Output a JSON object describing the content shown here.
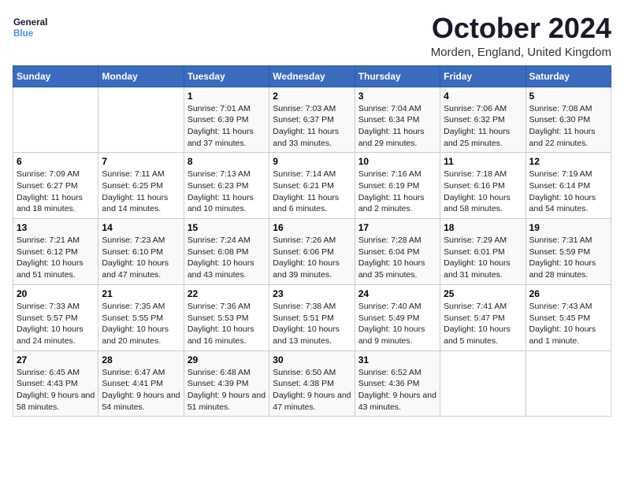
{
  "header": {
    "logo_line1": "General",
    "logo_line2": "Blue",
    "month_title": "October 2024",
    "location": "Morden, England, United Kingdom"
  },
  "days_of_week": [
    "Sunday",
    "Monday",
    "Tuesday",
    "Wednesday",
    "Thursday",
    "Friday",
    "Saturday"
  ],
  "weeks": [
    [
      {
        "num": "",
        "info": ""
      },
      {
        "num": "",
        "info": ""
      },
      {
        "num": "1",
        "info": "Sunrise: 7:01 AM\nSunset: 6:39 PM\nDaylight: 11 hours and 37 minutes."
      },
      {
        "num": "2",
        "info": "Sunrise: 7:03 AM\nSunset: 6:37 PM\nDaylight: 11 hours and 33 minutes."
      },
      {
        "num": "3",
        "info": "Sunrise: 7:04 AM\nSunset: 6:34 PM\nDaylight: 11 hours and 29 minutes."
      },
      {
        "num": "4",
        "info": "Sunrise: 7:06 AM\nSunset: 6:32 PM\nDaylight: 11 hours and 25 minutes."
      },
      {
        "num": "5",
        "info": "Sunrise: 7:08 AM\nSunset: 6:30 PM\nDaylight: 11 hours and 22 minutes."
      }
    ],
    [
      {
        "num": "6",
        "info": "Sunrise: 7:09 AM\nSunset: 6:27 PM\nDaylight: 11 hours and 18 minutes."
      },
      {
        "num": "7",
        "info": "Sunrise: 7:11 AM\nSunset: 6:25 PM\nDaylight: 11 hours and 14 minutes."
      },
      {
        "num": "8",
        "info": "Sunrise: 7:13 AM\nSunset: 6:23 PM\nDaylight: 11 hours and 10 minutes."
      },
      {
        "num": "9",
        "info": "Sunrise: 7:14 AM\nSunset: 6:21 PM\nDaylight: 11 hours and 6 minutes."
      },
      {
        "num": "10",
        "info": "Sunrise: 7:16 AM\nSunset: 6:19 PM\nDaylight: 11 hours and 2 minutes."
      },
      {
        "num": "11",
        "info": "Sunrise: 7:18 AM\nSunset: 6:16 PM\nDaylight: 10 hours and 58 minutes."
      },
      {
        "num": "12",
        "info": "Sunrise: 7:19 AM\nSunset: 6:14 PM\nDaylight: 10 hours and 54 minutes."
      }
    ],
    [
      {
        "num": "13",
        "info": "Sunrise: 7:21 AM\nSunset: 6:12 PM\nDaylight: 10 hours and 51 minutes."
      },
      {
        "num": "14",
        "info": "Sunrise: 7:23 AM\nSunset: 6:10 PM\nDaylight: 10 hours and 47 minutes."
      },
      {
        "num": "15",
        "info": "Sunrise: 7:24 AM\nSunset: 6:08 PM\nDaylight: 10 hours and 43 minutes."
      },
      {
        "num": "16",
        "info": "Sunrise: 7:26 AM\nSunset: 6:06 PM\nDaylight: 10 hours and 39 minutes."
      },
      {
        "num": "17",
        "info": "Sunrise: 7:28 AM\nSunset: 6:04 PM\nDaylight: 10 hours and 35 minutes."
      },
      {
        "num": "18",
        "info": "Sunrise: 7:29 AM\nSunset: 6:01 PM\nDaylight: 10 hours and 31 minutes."
      },
      {
        "num": "19",
        "info": "Sunrise: 7:31 AM\nSunset: 5:59 PM\nDaylight: 10 hours and 28 minutes."
      }
    ],
    [
      {
        "num": "20",
        "info": "Sunrise: 7:33 AM\nSunset: 5:57 PM\nDaylight: 10 hours and 24 minutes."
      },
      {
        "num": "21",
        "info": "Sunrise: 7:35 AM\nSunset: 5:55 PM\nDaylight: 10 hours and 20 minutes."
      },
      {
        "num": "22",
        "info": "Sunrise: 7:36 AM\nSunset: 5:53 PM\nDaylight: 10 hours and 16 minutes."
      },
      {
        "num": "23",
        "info": "Sunrise: 7:38 AM\nSunset: 5:51 PM\nDaylight: 10 hours and 13 minutes."
      },
      {
        "num": "24",
        "info": "Sunrise: 7:40 AM\nSunset: 5:49 PM\nDaylight: 10 hours and 9 minutes."
      },
      {
        "num": "25",
        "info": "Sunrise: 7:41 AM\nSunset: 5:47 PM\nDaylight: 10 hours and 5 minutes."
      },
      {
        "num": "26",
        "info": "Sunrise: 7:43 AM\nSunset: 5:45 PM\nDaylight: 10 hours and 1 minute."
      }
    ],
    [
      {
        "num": "27",
        "info": "Sunrise: 6:45 AM\nSunset: 4:43 PM\nDaylight: 9 hours and 58 minutes."
      },
      {
        "num": "28",
        "info": "Sunrise: 6:47 AM\nSunset: 4:41 PM\nDaylight: 9 hours and 54 minutes."
      },
      {
        "num": "29",
        "info": "Sunrise: 6:48 AM\nSunset: 4:39 PM\nDaylight: 9 hours and 51 minutes."
      },
      {
        "num": "30",
        "info": "Sunrise: 6:50 AM\nSunset: 4:38 PM\nDaylight: 9 hours and 47 minutes."
      },
      {
        "num": "31",
        "info": "Sunrise: 6:52 AM\nSunset: 4:36 PM\nDaylight: 9 hours and 43 minutes."
      },
      {
        "num": "",
        "info": ""
      },
      {
        "num": "",
        "info": ""
      }
    ]
  ]
}
